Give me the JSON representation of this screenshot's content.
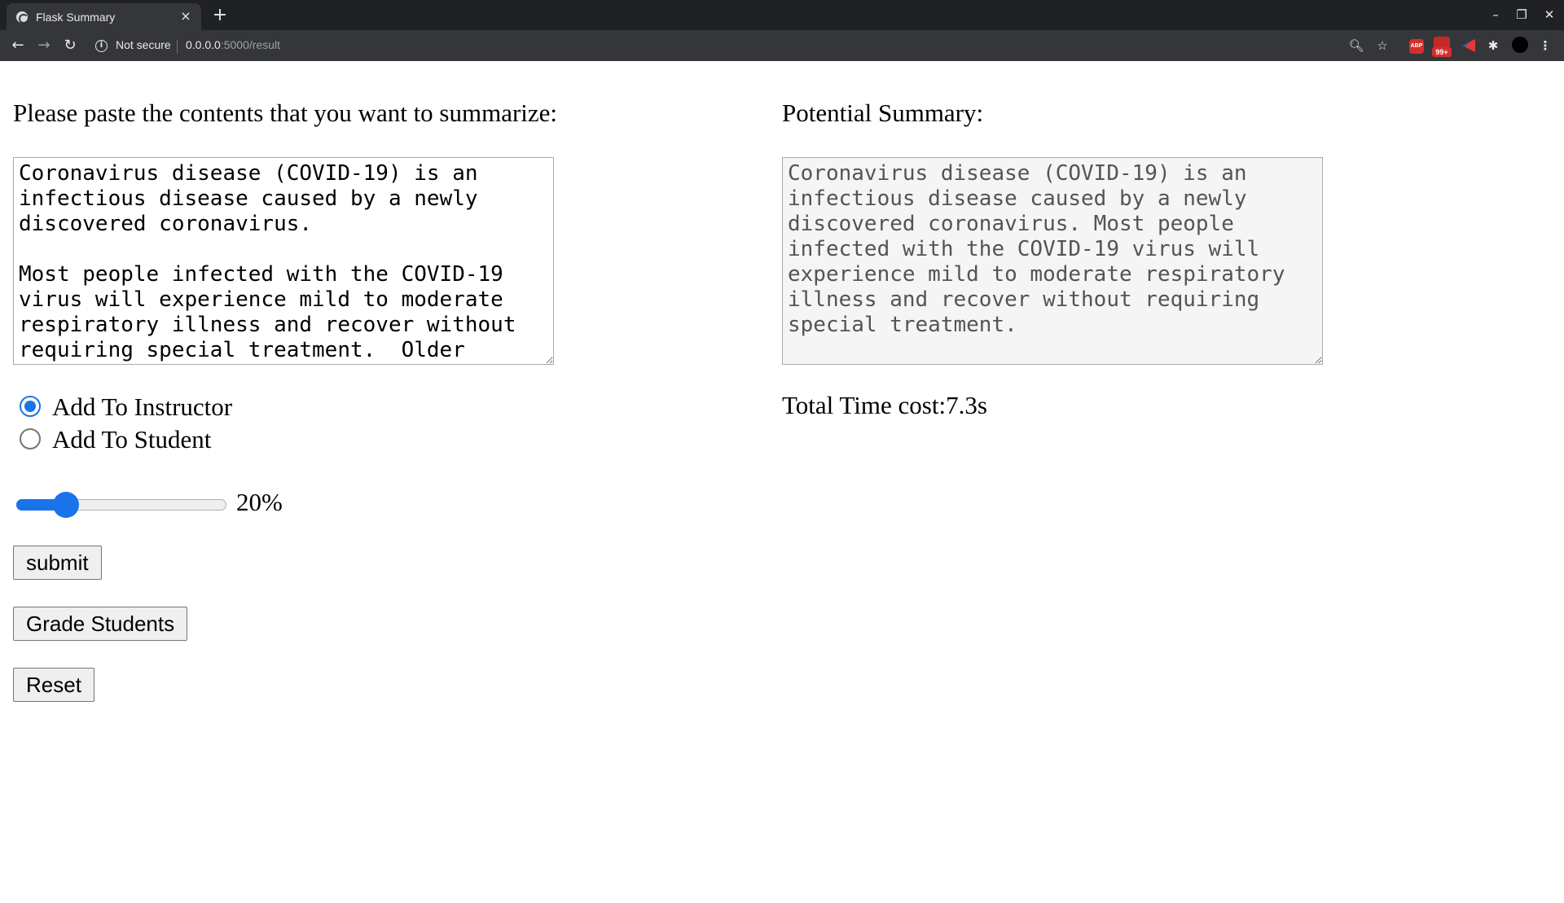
{
  "browser": {
    "tab_title": "Flask Summary",
    "tab_close": "×",
    "new_tab": "+",
    "not_secure": "Not secure",
    "url_host": "0.0.0.0",
    "url_path": ":5000/result",
    "badge_count": "99+",
    "abp_label": "ABP"
  },
  "left": {
    "prompt": "Please paste the contents that you want to summarize:",
    "input_text": "Coronavirus disease (COVID-19) is an infectious disease caused by a newly discovered coronavirus.\n\nMost people infected with the COVID-19 virus will experience mild to moderate respiratory illness and recover without requiring special treatment.  Older",
    "radio_options": [
      {
        "label": "Add To Instructor",
        "checked": true
      },
      {
        "label": "Add To Student",
        "checked": false
      }
    ],
    "slider": {
      "value_fraction": 0.2,
      "value_label": "20%"
    },
    "buttons": {
      "submit": "submit",
      "grade": "Grade Students",
      "reset": "Reset"
    }
  },
  "right": {
    "title": "Potential Summary:",
    "summary_text": "Coronavirus disease (COVID-19) is an infectious disease caused by a newly discovered coronavirus. Most people infected with the COVID-19 virus will experience mild to moderate respiratory illness and recover without requiring special treatment.",
    "time_cost": "Total Time cost:7.3s"
  },
  "colors": {
    "accent": "#1a73e8",
    "chrome_dark": "#202124",
    "chrome_toolbar": "#35363a"
  }
}
